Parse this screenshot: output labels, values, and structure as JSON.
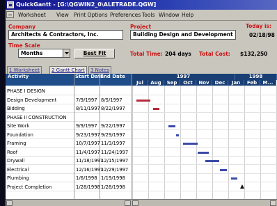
{
  "window": {
    "title": "QuickGantt - [G:\\QGWIN2_0\\ALETRADE.QGW]"
  },
  "menu": [
    "Worksheet",
    "View",
    "Print Options",
    "Preferences",
    "Tools",
    "Window",
    "Help"
  ],
  "header": {
    "company_label": "Company",
    "company_value": "Architects & Contractors, Inc.",
    "project_label": "Project",
    "project_value": "Building Design and Development",
    "today_label": "Today is:",
    "today_value": "02/18/98",
    "timescale_label": "Time Scale",
    "timescale_value": "Months",
    "best_fit_label": "Best Fit",
    "total_time_label": "Total Time:",
    "total_time_value": "204 days",
    "total_cost_label": "Total Cost:",
    "total_cost_value": "$132,250"
  },
  "tabs": [
    "1 Worksheet",
    "2 Gantt Chart",
    "3 Notes"
  ],
  "columns": {
    "activity": "Activity",
    "start": "Start Date",
    "end": "End Date"
  },
  "timeline": {
    "years": [
      "1997",
      "1998"
    ],
    "months": [
      "Jul",
      "Aug",
      "Sep",
      "Oct",
      "Nov",
      "Dec",
      "Jan",
      "Feb",
      "M..."
    ]
  },
  "rows": [
    {
      "activity": "PHASE I DESIGN",
      "start": "",
      "end": "",
      "phase": true
    },
    {
      "activity": "Design Development",
      "start": "7/9/1997",
      "end": "8/5/1997"
    },
    {
      "activity": "Bidding",
      "start": "8/11/1997",
      "end": "8/22/1997"
    },
    {
      "activity": "PHASE II CONSTRUCTION",
      "start": "",
      "end": "",
      "phase": true
    },
    {
      "activity": "Site Work",
      "start": "9/9/1997",
      "end": "9/22/1997"
    },
    {
      "activity": "Foundation",
      "start": "9/23/1997",
      "end": "9/29/1997"
    },
    {
      "activity": "Framing",
      "start": "10/7/1997",
      "end": "11/3/1997"
    },
    {
      "activity": "Roof",
      "start": "11/4/1997",
      "end": "11/24/1997"
    },
    {
      "activity": "Drywall",
      "start": "11/18/1997",
      "end": "12/15/1997"
    },
    {
      "activity": "Electrical",
      "start": "12/16/1997",
      "end": "12/29/1997"
    },
    {
      "activity": "Plumbing",
      "start": "1/6/1998",
      "end": "1/19/1998"
    },
    {
      "activity": "Project Completion",
      "start": "1/28/1998",
      "end": "1/28/1998"
    }
  ],
  "colors": {
    "bar_design": "#b22a3c",
    "bar_construction": "#3b4aa8",
    "milestone": "#111111",
    "header_bg": "#1f4d8a",
    "label_red": "#c81414"
  }
}
